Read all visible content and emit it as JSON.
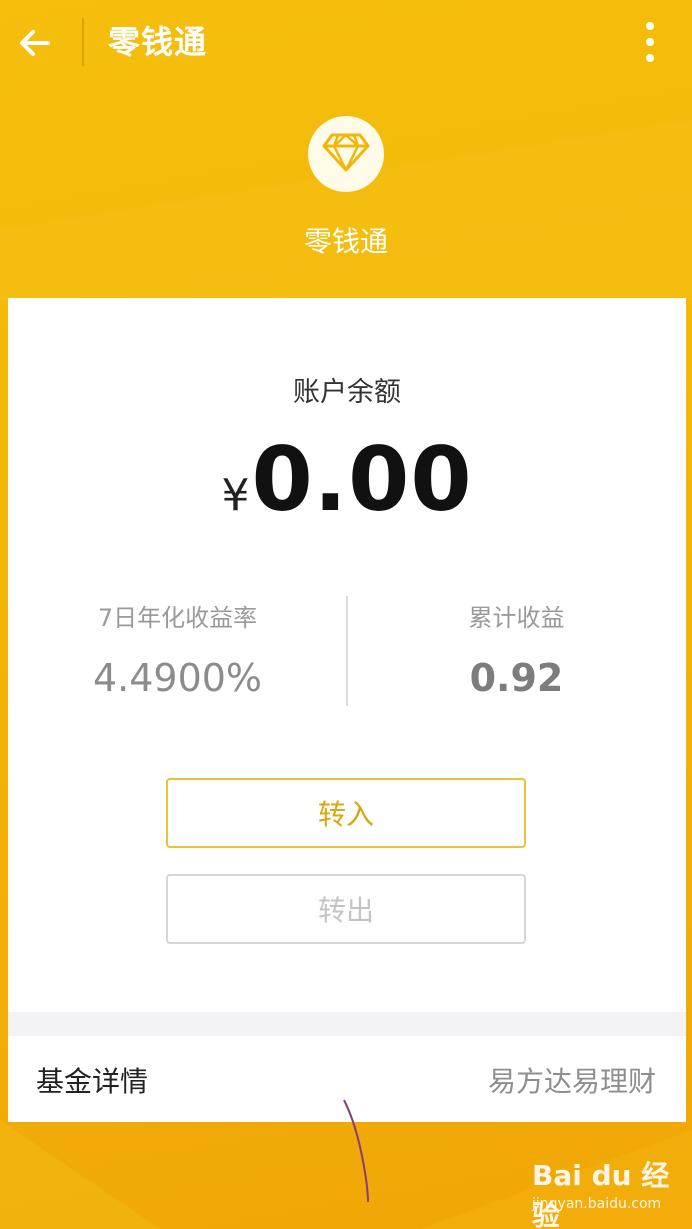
{
  "appbar": {
    "title": "零钱通",
    "back_icon": "arrow-left-icon",
    "more_icon": "more-vertical-icon"
  },
  "brand": {
    "icon": "diamond-icon",
    "name": "零钱通"
  },
  "balance": {
    "label": "账户余额",
    "currency": "¥",
    "amount": "0.00"
  },
  "stats": {
    "yield_label": "7日年化收益率",
    "yield_value": "4.4900%",
    "earnings_label": "累计收益",
    "earnings_value": "0.92"
  },
  "actions": {
    "transfer_in": "转入",
    "transfer_out": "转出"
  },
  "fund": {
    "label": "基金详情",
    "value": "易方达易理财"
  },
  "watermark": {
    "logo": "Bai du 经验",
    "url": "jingyan.baidu.com"
  },
  "colors": {
    "background": "#f3b80a",
    "accent": "#d7a90f",
    "card": "#ffffff"
  }
}
